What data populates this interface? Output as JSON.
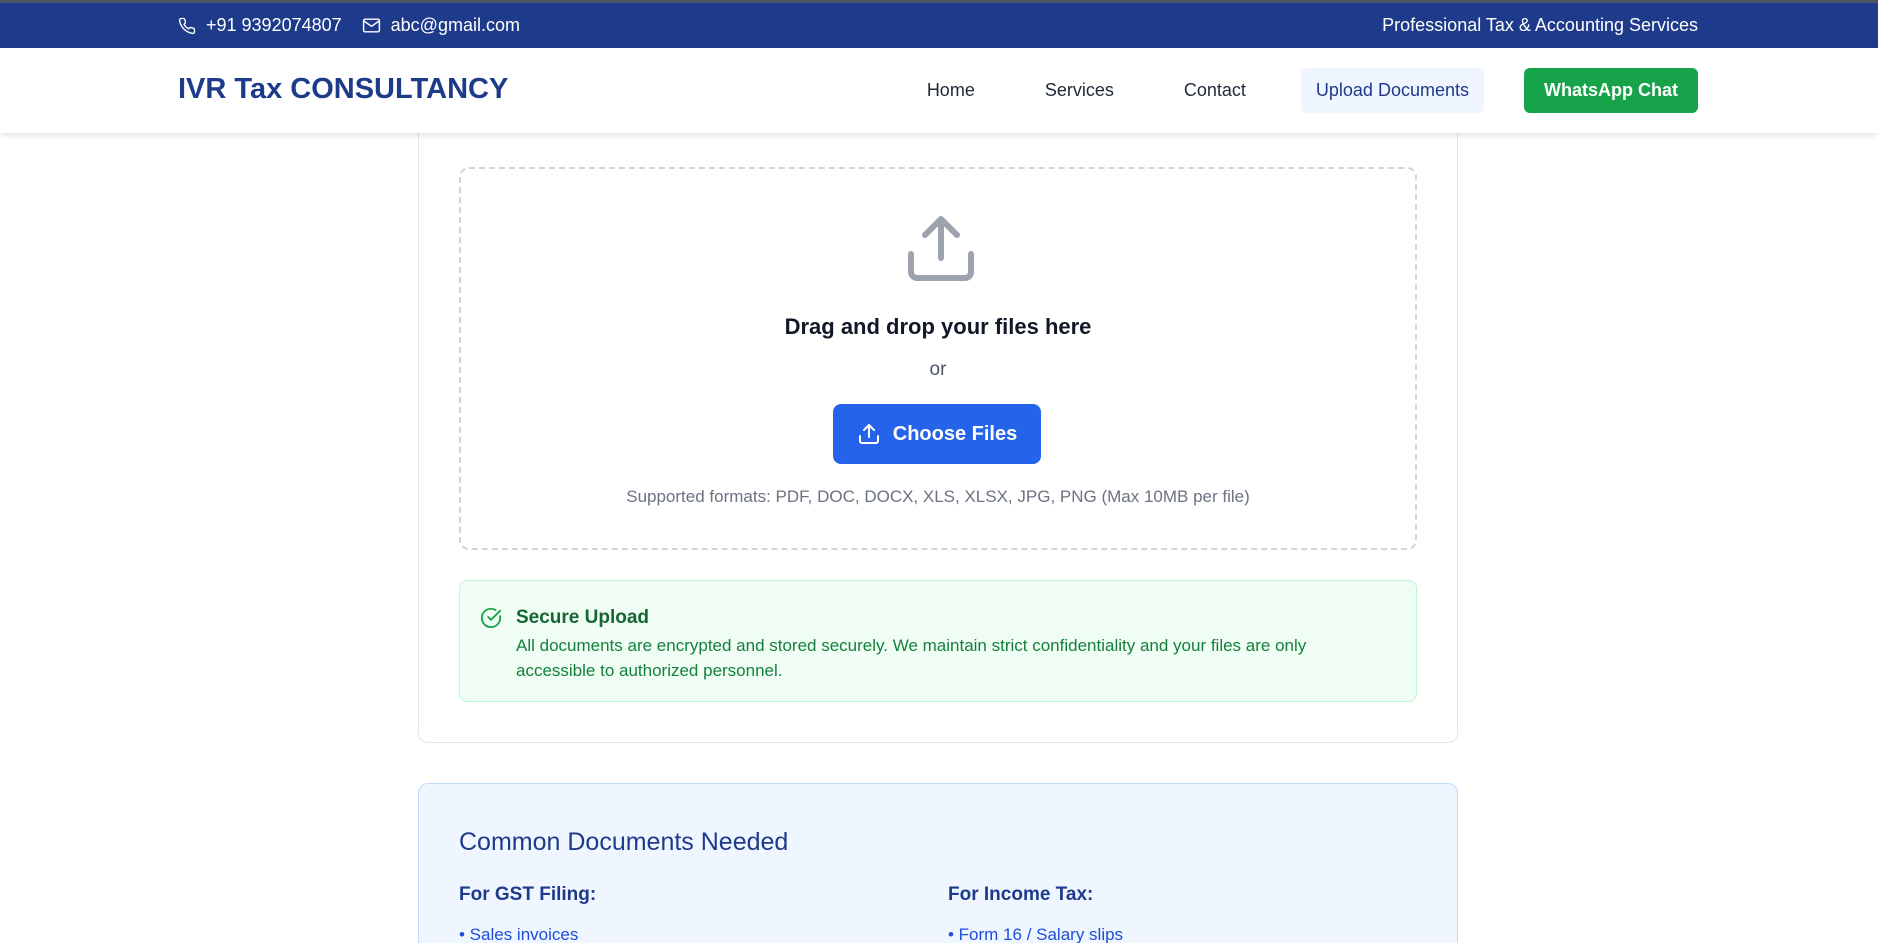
{
  "topbar": {
    "phone": "+91 9392074807",
    "email": "abc@gmail.com",
    "tagline": "Professional Tax & Accounting Services"
  },
  "navbar": {
    "brand": "IVR Tax CONSULTANCY",
    "links": [
      "Home",
      "Services",
      "Contact",
      "Upload Documents"
    ],
    "active_link": "Upload Documents",
    "whatsapp": "WhatsApp Chat"
  },
  "upload": {
    "drag_text": "Drag and drop your files here",
    "or_text": "or",
    "button_label": "Choose Files",
    "formats": "Supported formats: PDF, DOC, DOCX, XLS, XLSX, JPG, PNG (Max 10MB per file)"
  },
  "secure": {
    "title": "Secure Upload",
    "text": "All documents are encrypted and stored securely. We maintain strict confidentiality and your files are only accessible to authorized personnel."
  },
  "documents": {
    "title": "Common Documents Needed",
    "gst_heading": "For GST Filing:",
    "gst_items": [
      "• Sales invoices"
    ],
    "income_heading": "For Income Tax:",
    "income_items": [
      "• Form 16 / Salary slips"
    ]
  },
  "colors": {
    "primary": "#1e3a8a",
    "button_blue": "#2563eb",
    "whatsapp_green": "#16a34a",
    "secure_green": "#166534"
  },
  "icons": {
    "phone": "phone-icon",
    "email": "mail-icon",
    "upload_large": "upload-icon",
    "upload_button": "upload-icon",
    "secure": "check-circle-icon"
  }
}
